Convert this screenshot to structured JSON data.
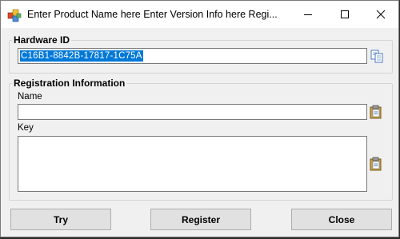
{
  "window": {
    "title": "Enter Product Name here Enter Version Info here Regi...",
    "controls": {
      "minimize": "minimize",
      "maximize": "maximize",
      "close": "close"
    }
  },
  "hardware": {
    "legend": "Hardware ID",
    "value": "C16B1-8842B-17817-1C75A",
    "copy_icon": "copy-icon"
  },
  "registration": {
    "legend": "Registration Information",
    "name_label": "Name",
    "name_value": "",
    "key_label": "Key",
    "key_value": "",
    "paste_icon": "paste-icon"
  },
  "buttons": {
    "try": "Try",
    "register": "Register",
    "close": "Close"
  },
  "colors": {
    "selection": "#0078d7",
    "window_bg": "#f0f0f0",
    "button_bg": "#e1e1e1"
  }
}
